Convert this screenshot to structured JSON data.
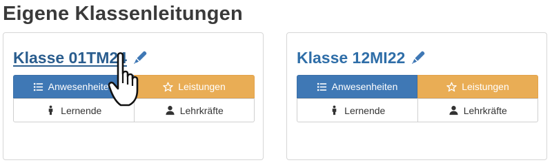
{
  "page": {
    "title": "Eigene Klassenleitungen"
  },
  "classes": [
    {
      "title": "Klasse 01TM24",
      "buttons": {
        "attendance": "Anwesenheiten",
        "performance": "Leistungen",
        "students": "Lernende",
        "teachers": "Lehrkräfte"
      }
    },
    {
      "title": "Klasse 12MI22",
      "buttons": {
        "attendance": "Anwesenheiten",
        "performance": "Leistungen",
        "students": "Lernende",
        "teachers": "Lehrkräfte"
      }
    }
  ],
  "colors": {
    "primary": "#3f78b5",
    "warning": "#e9ad55",
    "link": "#2f6ea8"
  },
  "icons": [
    "edit-pen-icon",
    "list-icon",
    "star-icon",
    "person-icon",
    "user-icon",
    "hand-pointer-cursor-icon"
  ]
}
